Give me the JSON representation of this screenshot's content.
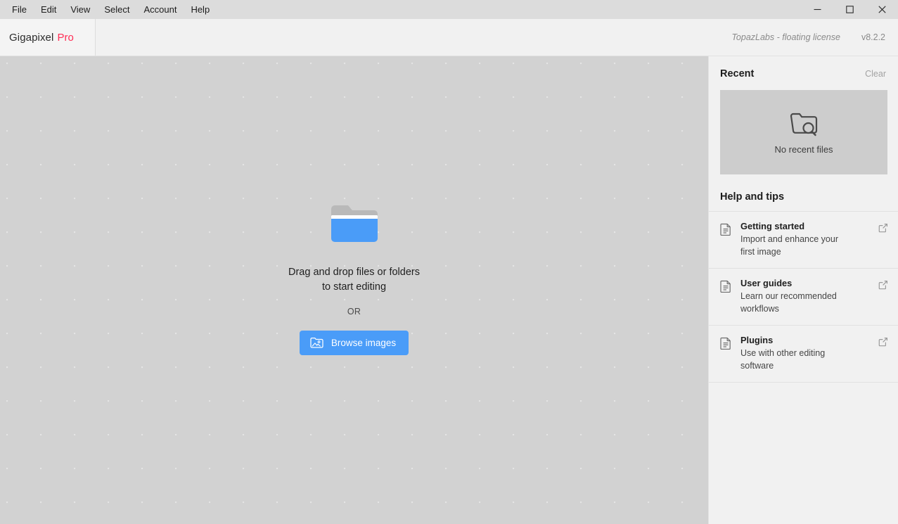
{
  "window": {
    "menu": [
      {
        "label": "File"
      },
      {
        "label": "Edit"
      },
      {
        "label": "View"
      },
      {
        "label": "Select"
      },
      {
        "label": "Account"
      },
      {
        "label": "Help"
      }
    ],
    "controls": {
      "minimize": "minimize-icon",
      "maximize": "maximize-icon",
      "close": "close-icon"
    }
  },
  "header": {
    "app_name": "Gigapixel",
    "edition": "Pro",
    "license": "TopazLabs - floating license",
    "version": "v8.2.2"
  },
  "canvas": {
    "folder_icon": "folder-icon",
    "drop_text_line1": "Drag and drop files or folders",
    "drop_text_line2": "to start editing",
    "or_label": "OR",
    "browse_button": {
      "label": "Browse images",
      "icon": "image-folder-icon"
    }
  },
  "sidebar": {
    "recent": {
      "title": "Recent",
      "clear_label": "Clear",
      "empty_icon": "folder-search-icon",
      "empty_label": "No recent files"
    },
    "help": {
      "title": "Help and tips",
      "items": [
        {
          "icon": "document-icon",
          "title": "Getting started",
          "desc": "Import and enhance your first image",
          "link_icon": "external-link-icon"
        },
        {
          "icon": "document-icon",
          "title": "User guides",
          "desc": "Learn our recommended workflows",
          "link_icon": "external-link-icon"
        },
        {
          "icon": "document-icon",
          "title": "Plugins",
          "desc": "Use with other editing software",
          "link_icon": "external-link-icon"
        }
      ]
    }
  },
  "colors": {
    "accent_blue": "#4a9cf8",
    "pro_pink": "#ff2d55",
    "titlebar": "#dcdcdc",
    "canvas": "#d2d2d2",
    "sidebar": "#f1f1f1"
  }
}
